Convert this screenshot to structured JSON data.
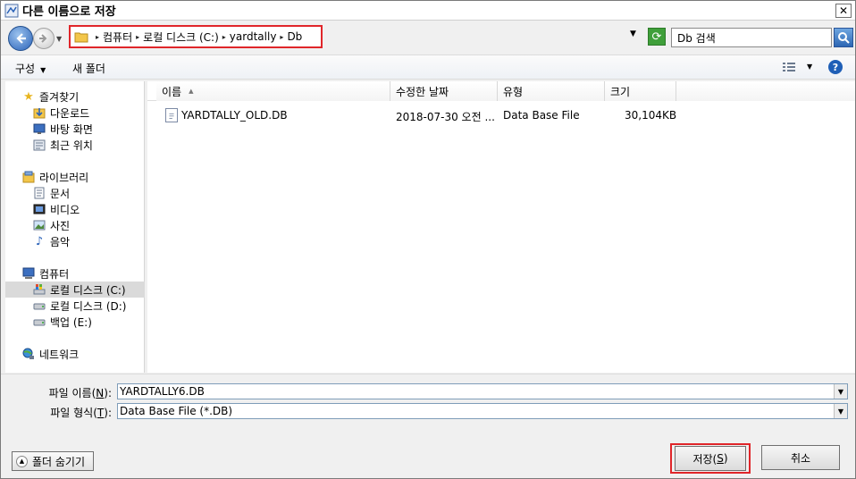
{
  "window": {
    "title": "다른 이름으로 저장",
    "close_label": "✕"
  },
  "address": {
    "breadcrumb": [
      "컴퓨터",
      "로컬 디스크 (C:)",
      "yardtally",
      "Db"
    ],
    "search_placeholder": "Db 검색"
  },
  "toolbar": {
    "organize_label": "구성",
    "new_folder_label": "새 폴더",
    "help_label": "?"
  },
  "navpane": {
    "favorites": {
      "label": "즐겨찾기",
      "items": [
        "다운로드",
        "바탕 화면",
        "최근 위치"
      ]
    },
    "libraries": {
      "label": "라이브러리",
      "items": [
        "문서",
        "비디오",
        "사진",
        "음악"
      ]
    },
    "computer": {
      "label": "컴퓨터",
      "items": [
        "로컬 디스크 (C:)",
        "로컬 디스크 (D:)",
        "백업 (E:)"
      ]
    },
    "network": {
      "label": "네트워크"
    }
  },
  "filelist": {
    "columns": [
      "이름",
      "수정한 날짜",
      "유형",
      "크기"
    ],
    "rows": [
      {
        "name": "YARDTALLY_OLD.DB",
        "modified": "2018-07-30 오전 ...",
        "type": "Data Base File",
        "size": "30,104KB"
      }
    ]
  },
  "form": {
    "filename_label_prefix": "파일 이름(",
    "filename_label_key": "N",
    "filename_label_suffix": "):",
    "filename_value": "YARDTALLY6.DB",
    "filetype_label_prefix": "파일 형식(",
    "filetype_label_key": "T",
    "filetype_label_suffix": "):",
    "filetype_value": "Data Base File (*.DB)"
  },
  "buttons": {
    "hide_folders_label": "폴더 숨기기",
    "save_prefix": "저장(",
    "save_key": "S",
    "save_suffix": ")",
    "cancel_label": "취소"
  },
  "colors": {
    "highlight_border": "#e0262a",
    "accent_blue": "#2a62b8"
  }
}
